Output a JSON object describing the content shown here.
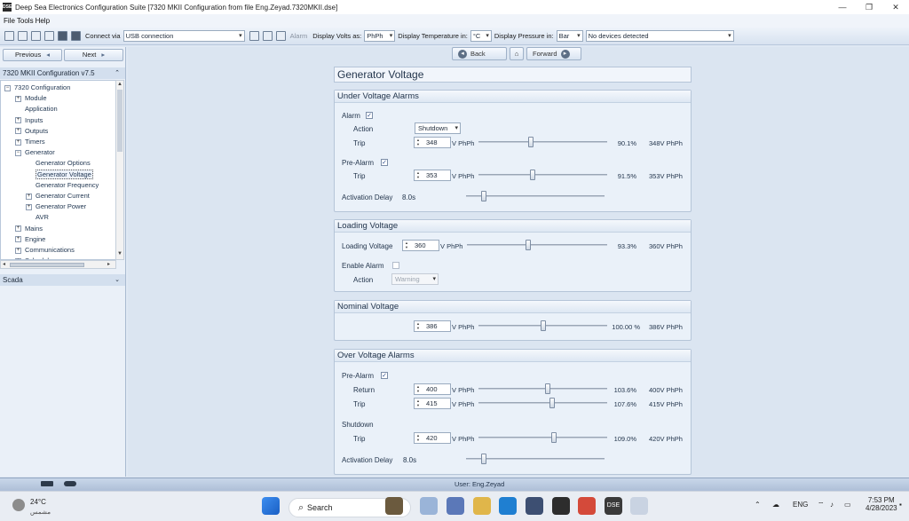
{
  "window": {
    "title": "Deep Sea Electronics Configuration Suite [7320 MKII Configuration from file Eng.Zeyad.7320MKII.dse]",
    "app_icon_text": "DSE",
    "controls": [
      "—",
      "❐",
      "✕"
    ]
  },
  "menu": [
    "File",
    "Tools",
    "Help"
  ],
  "toolbar": {
    "connect_via_label": "Connect via",
    "connect_via_value": "USB connection",
    "alarm_label": "Alarm",
    "display_volts_label": "Display Volts as:",
    "display_volts_value": "PhPh",
    "display_temp_label": "Display Temperature in:",
    "display_temp_value": "°C",
    "display_pressure_label": "Display Pressure in:",
    "display_pressure_value": "Bar",
    "devices_value": "No devices detected"
  },
  "left_nav": {
    "previous_label": "Previous",
    "next_label": "Next",
    "config_header": "7320 MKII Configuration v7.5",
    "scada_label": "Scada",
    "tree": [
      {
        "label": "7320 Configuration",
        "indent": 0,
        "exp": "−"
      },
      {
        "label": "Module",
        "indent": 1,
        "exp": "+"
      },
      {
        "label": "Application",
        "indent": 1,
        "exp": ""
      },
      {
        "label": "Inputs",
        "indent": 1,
        "exp": "+"
      },
      {
        "label": "Outputs",
        "indent": 1,
        "exp": "+"
      },
      {
        "label": "Timers",
        "indent": 1,
        "exp": "+"
      },
      {
        "label": "Generator",
        "indent": 1,
        "exp": "−"
      },
      {
        "label": "Generator Options",
        "indent": 2,
        "exp": ""
      },
      {
        "label": "Generator Voltage",
        "indent": 2,
        "exp": "",
        "selected": true
      },
      {
        "label": "Generator Frequency",
        "indent": 2,
        "exp": ""
      },
      {
        "label": "Generator Current",
        "indent": 2,
        "exp": "+"
      },
      {
        "label": "Generator Power",
        "indent": 2,
        "exp": "+"
      },
      {
        "label": "AVR",
        "indent": 2,
        "exp": ""
      },
      {
        "label": "Mains",
        "indent": 1,
        "exp": "+"
      },
      {
        "label": "Engine",
        "indent": 1,
        "exp": "+"
      },
      {
        "label": "Communications",
        "indent": 1,
        "exp": "+"
      },
      {
        "label": "Scheduler",
        "indent": 1,
        "exp": "+"
      }
    ]
  },
  "topnav": {
    "back_label": "Back",
    "forward_label": "Forward"
  },
  "page": {
    "title": "Generator Voltage",
    "under_voltage": {
      "title": "Under Voltage Alarms",
      "alarm_label": "Alarm",
      "alarm_checked": "✓",
      "action_label": "Action",
      "action_value": "Shutdown",
      "trip_label": "Trip",
      "trip_value": "348",
      "trip_unit": "V PhPh",
      "trip_pct": "90.1%",
      "trip_volts": "348V PhPh",
      "trip_level": 0.901,
      "prealarm_label": "Pre-Alarm",
      "prealarm_checked": "✓",
      "pre_trip_label": "Trip",
      "pre_trip_value": "353",
      "pre_trip_unit": "V PhPh",
      "pre_trip_pct": "91.5%",
      "pre_trip_volts": "353V PhPh",
      "pre_trip_level": 0.915,
      "delay_label": "Activation Delay",
      "delay_value": "8.0s"
    },
    "loading_voltage": {
      "title": "Loading Voltage",
      "label": "Loading Voltage",
      "value": "360",
      "unit": "V PhPh",
      "pct": "93.3%",
      "volts": "360V PhPh",
      "level": 0.933,
      "enable_alarm_label": "Enable Alarm",
      "action_label": "Action",
      "action_value": "Warning"
    },
    "nominal_voltage": {
      "title": "Nominal Voltage",
      "value": "386",
      "unit": "V PhPh",
      "pct": "100.00 %",
      "volts": "386V PhPh",
      "level": 1.0
    },
    "over_voltage": {
      "title": "Over Voltage Alarms",
      "prealarm_label": "Pre-Alarm",
      "prealarm_checked": "✓",
      "return_label": "Return",
      "return_value": "400",
      "return_unit": "V PhPh",
      "return_pct": "103.6%",
      "return_volts": "400V PhPh",
      "return_level": 1.036,
      "trip_label": "Trip",
      "trip_value": "415",
      "trip_unit": "V PhPh",
      "trip_pct": "107.6%",
      "trip_volts": "415V PhPh",
      "trip_level": 1.076,
      "shutdown_label": "Shutdown",
      "sd_trip_label": "Trip",
      "sd_trip_value": "420",
      "sd_trip_unit": "V PhPh",
      "sd_trip_pct": "109.0%",
      "sd_trip_volts": "420V PhPh",
      "sd_trip_level": 1.09,
      "delay_label": "Activation Delay",
      "delay_value": "8.0s"
    }
  },
  "status_bar": {
    "user_label": "User: Eng.Zeyad"
  },
  "taskbar": {
    "temperature": "24°C",
    "weather_text": "مشمس",
    "search_label": "Search",
    "language": "ENG",
    "time": "7:53 PM",
    "date": "4/28/2023",
    "dse_label": "DSE"
  },
  "colors": {
    "accent": "#24364d",
    "panel": "#eaf1f9",
    "background": "#dbe5f1"
  }
}
